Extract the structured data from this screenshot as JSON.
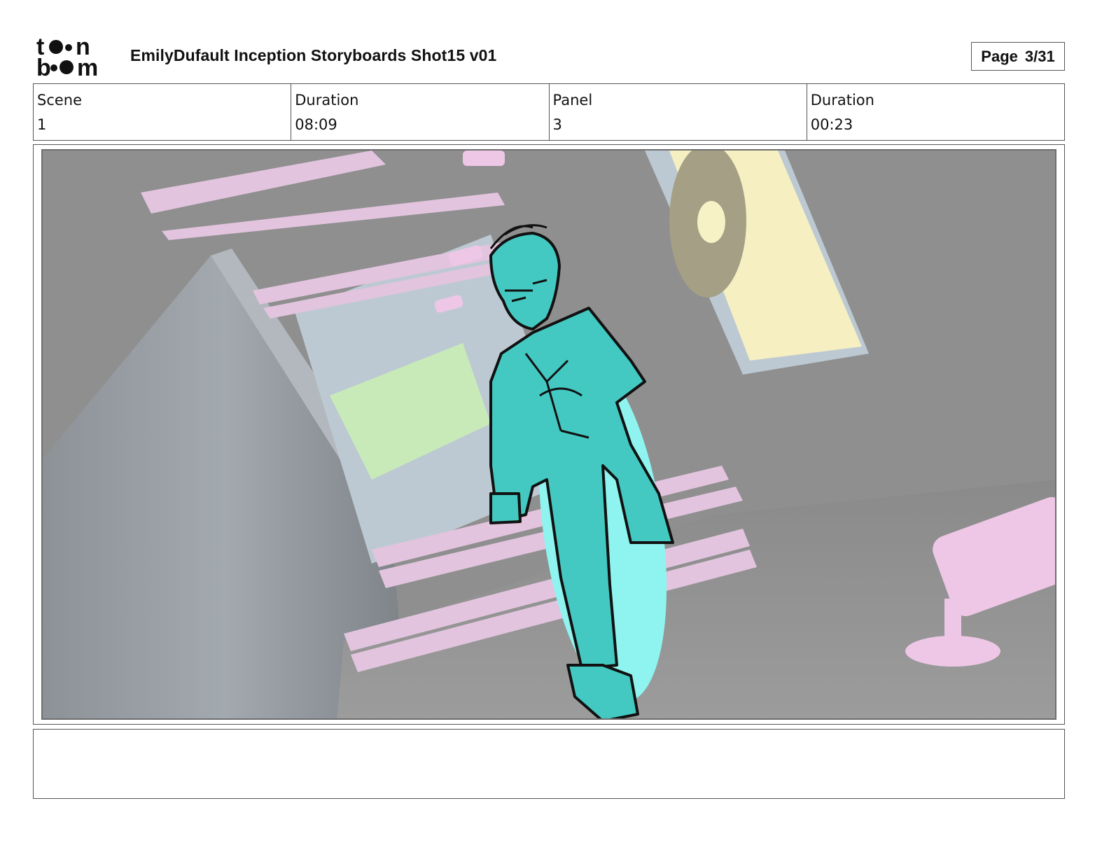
{
  "header": {
    "logo_text": "toon boom",
    "title": "EmilyDufault Inception Storyboards Shot15 v01",
    "page_label": "Page",
    "page_value": "3/31"
  },
  "info": [
    {
      "label": "Scene",
      "value": "1"
    },
    {
      "label": "Duration",
      "value": "08:09"
    },
    {
      "label": "Panel",
      "value": "3"
    },
    {
      "label": "Duration",
      "value": "00:23"
    }
  ],
  "notes": {
    "text": ""
  },
  "colors": {
    "character": "#44c9c2",
    "character_glow": "#8ff4ef",
    "set_pink": "#e2c4de",
    "set_yellow": "#f5efc2",
    "set_green": "#c8eab9",
    "set_blue": "#bdc9d2",
    "background": "#8f8f8f"
  }
}
